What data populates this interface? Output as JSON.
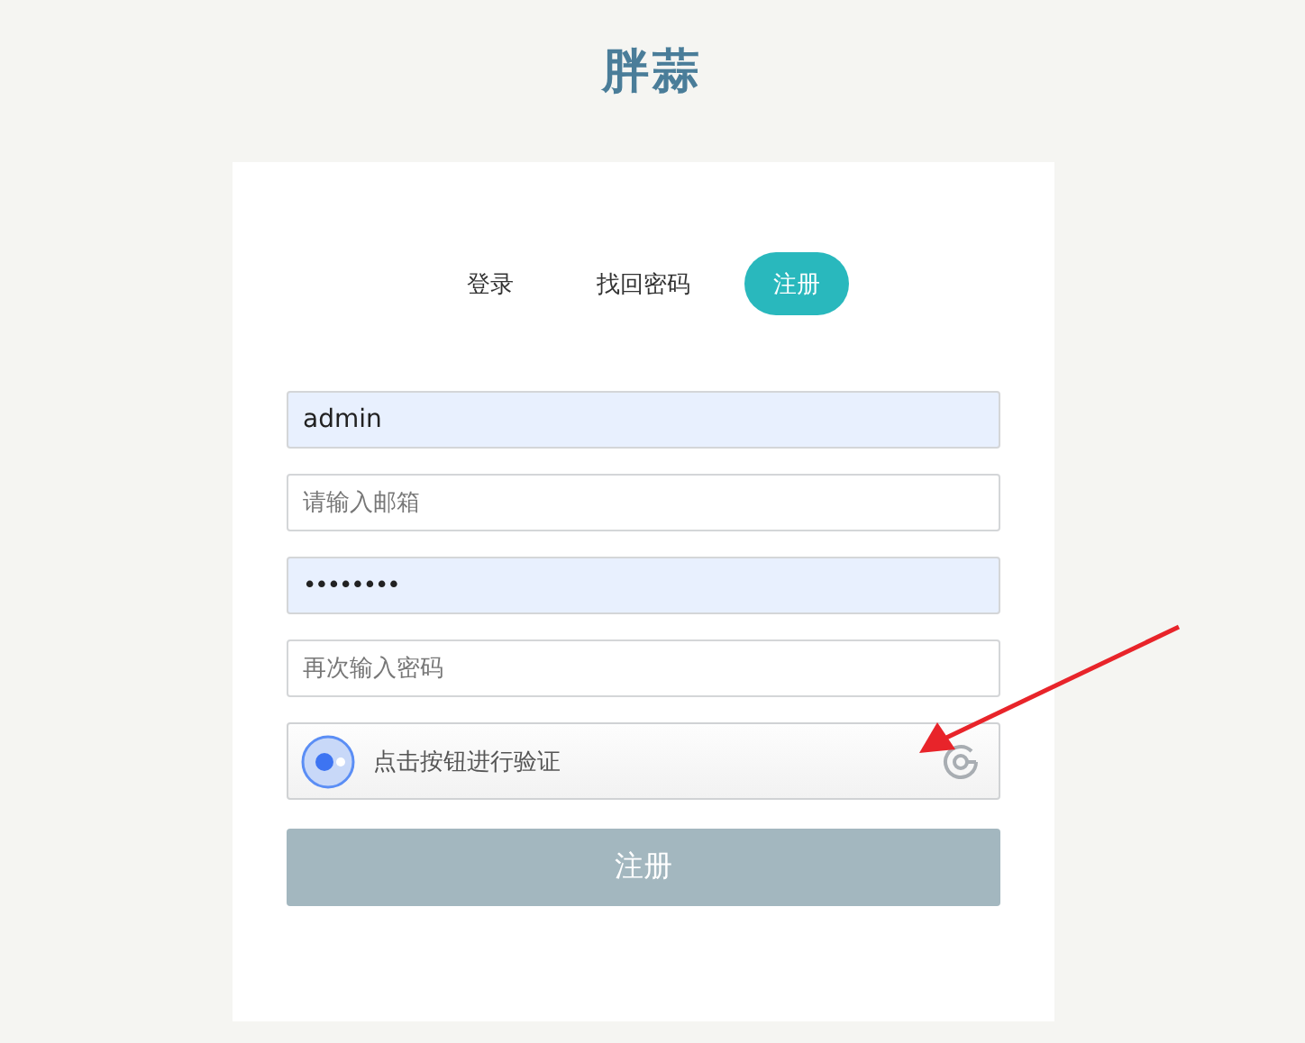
{
  "title": "胖蒜",
  "tabs": [
    {
      "label": "登录",
      "selected": false
    },
    {
      "label": "找回密码",
      "selected": false
    },
    {
      "label": "注册",
      "selected": true
    }
  ],
  "fields": [
    {
      "kind": "text",
      "value": "admin",
      "autofilled": true
    },
    {
      "kind": "text",
      "placeholder": "请输入邮箱",
      "autofilled": false
    },
    {
      "kind": "password",
      "value": "••••••••",
      "autofilled": true
    },
    {
      "kind": "text",
      "placeholder": "再次输入密码",
      "autofilled": false
    }
  ],
  "captcha": {
    "label": "点击按钮进行验证"
  },
  "submit": {
    "label": "注册",
    "disabled": true
  }
}
